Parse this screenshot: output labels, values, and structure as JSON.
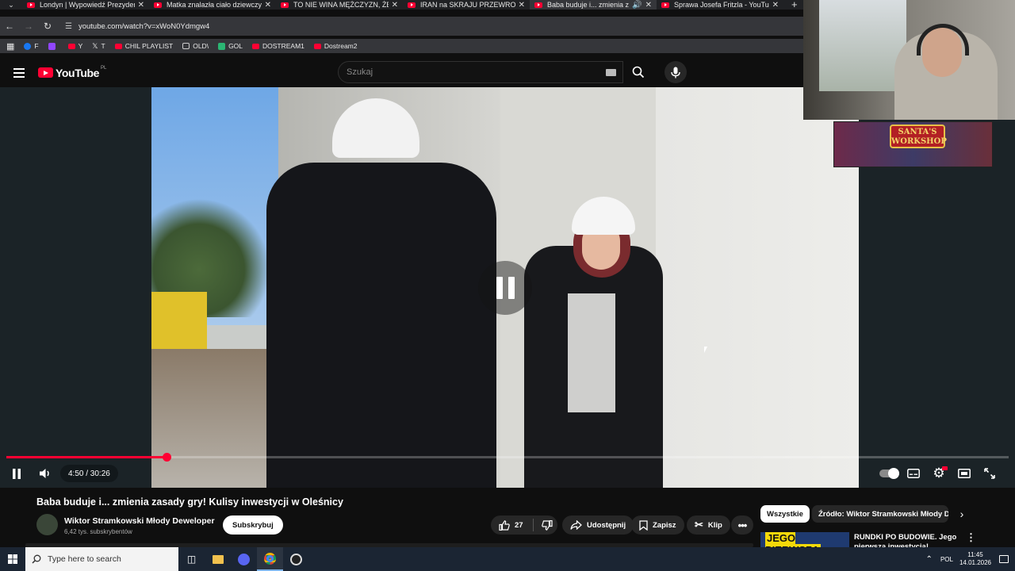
{
  "browser": {
    "tabs": [
      {
        "title": "Londyn | Wypowiedź Prezydenta",
        "active": false
      },
      {
        "title": "Matka znalazła ciało dziewczyny",
        "active": false
      },
      {
        "title": "TO NIE WINA MĘŻCZYZN, ŻE PŁ",
        "active": false
      },
      {
        "title": "IRAN na SKRAJU PRZEWROTU",
        "active": false
      },
      {
        "title": "Baba buduje i... zmienia zasady",
        "active": true
      },
      {
        "title": "Sprawa Josefa Fritzla - YouTube",
        "active": false
      }
    ],
    "url": "youtube.com/watch?v=xWoN0Ydmgw4",
    "bookmarks": [
      {
        "label": "F",
        "color": "#1877f2"
      },
      {
        "label": "",
        "color": "#9146ff"
      },
      {
        "label": "Y",
        "color": "#ff0033"
      },
      {
        "label": "T",
        "color": "#000000"
      },
      {
        "label": "CHIL PLAYLIST",
        "color": "#ff0033"
      },
      {
        "label": "OLD\\",
        "color": "folder"
      },
      {
        "label": "GOL",
        "color": "#2bb673"
      },
      {
        "label": "DOSTREAM1",
        "color": "#ff0033"
      },
      {
        "label": "Dostream2",
        "color": "#ff0033"
      }
    ]
  },
  "youtube": {
    "logo": "YouTube",
    "region": "PL",
    "search_placeholder": "Szukaj"
  },
  "player": {
    "time": "4:50 / 30:26",
    "progress": 0.16,
    "paused": true
  },
  "overlay": {
    "santa_sign": "SANTA'S WORKSHOP"
  },
  "video": {
    "title": "Baba buduje i... zmienia zasady gry! Kulisy inwestycji w Oleśnicy",
    "channel": "Wiktor Stramkowski  Młody Deweloper",
    "subscribers": "6,42 tys. subskrybentów",
    "subscribe_label": "Subskrybuj",
    "likes": "27",
    "share_label": "Udostępnij",
    "save_label": "Zapisz",
    "clip_label": "Klip"
  },
  "sidebar": {
    "chips": [
      "Wszystkie",
      "Źródło: Wiktor Stramkowski Młody Deweloper"
    ],
    "rec_thumb_text": "JEGO PIERWSZA",
    "rec_title": "RUNDKI PO BUDOWIE. Jego pierwsza inwestycja!"
  },
  "taskbar": {
    "search_placeholder": "Type here to search",
    "lang": "POL",
    "time": "11:45",
    "date": "14.01.2026"
  },
  "colors": {
    "accent": "#ff0033",
    "background": "#0f0f0f",
    "taskbar": "#1b2533"
  }
}
